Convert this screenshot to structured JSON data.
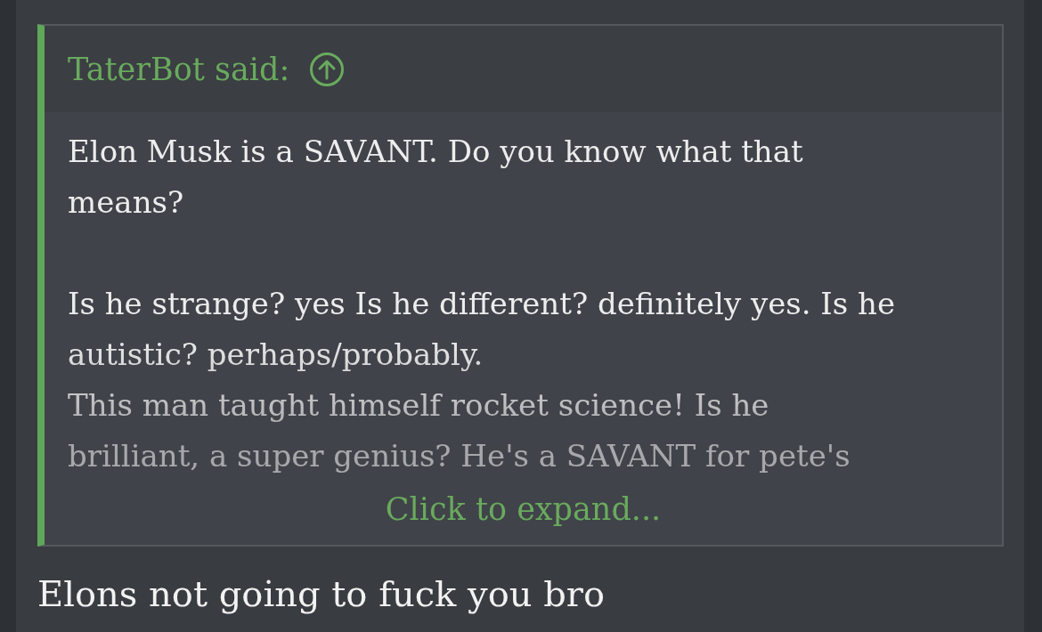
{
  "quote": {
    "author": "TaterBot said:",
    "paragraphs": [
      [
        "Elon Musk is a SAVANT. Do you know what that",
        "means?"
      ],
      [
        "Is he strange? yes Is he different? definitely yes. Is he",
        "autistic? perhaps/probably.",
        "This man taught himself rocket science! Is he",
        "brilliant, a super genius? He's a SAVANT for pete's"
      ]
    ],
    "expand_link": "Click to expand..."
  },
  "reply": "Elons not going to fuck you bro"
}
